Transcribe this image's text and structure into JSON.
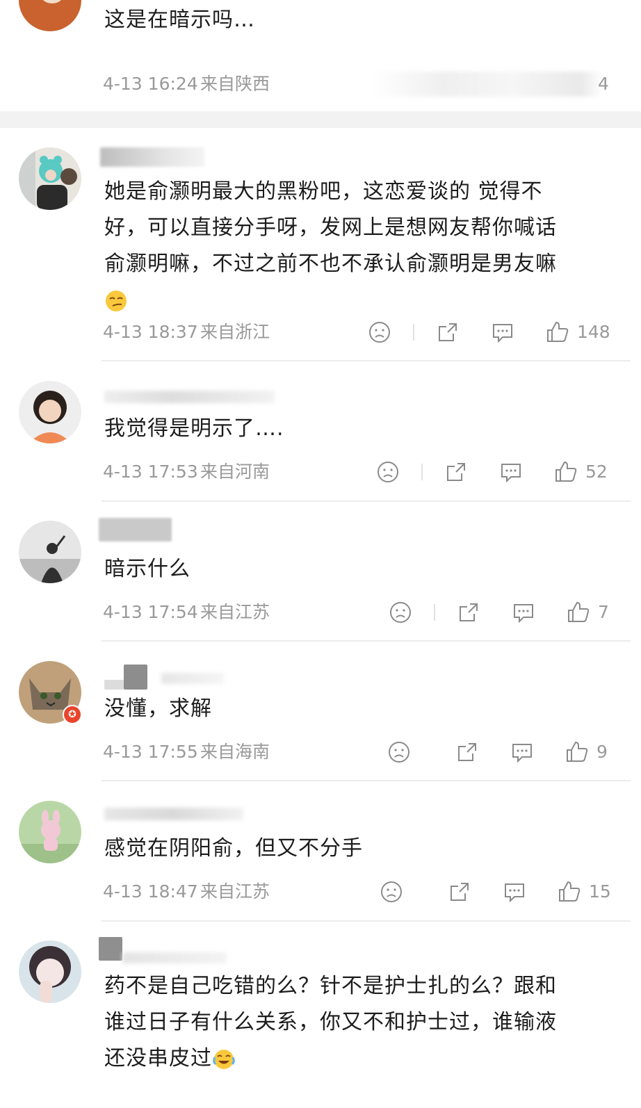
{
  "top_comment": {
    "text": "这是在暗示吗…",
    "date": "4-13 16:24",
    "location": "来自陕西",
    "likes": "4"
  },
  "comments": [
    {
      "text_lines": [
        "她是俞灏明最大的黑粉吧，这恋爱谈的 觉得不",
        "好，可以直接分手呀，发网上是想网友帮你喊话",
        "俞灏明嘛，不过之前不也不承认俞灏明是男友嘛"
      ],
      "trailing_emoji": "smirk-emoji",
      "date": "4-13 18:37",
      "location": "来自浙江",
      "likes": "148"
    },
    {
      "text": "我觉得是明示了….",
      "date": "4-13 17:53",
      "location": "来自河南",
      "likes": "52"
    },
    {
      "text": "暗示什么",
      "date": "4-13 17:54",
      "location": "来自江苏",
      "likes": "7"
    },
    {
      "text": "没懂，求解",
      "date": "4-13 17:55",
      "location": "来自海南",
      "likes": "9"
    },
    {
      "text": "感觉在阴阳俞，但又不分手",
      "date": "4-13 18:47",
      "location": "来自江苏",
      "likes": "15"
    },
    {
      "text_lines": [
        "药不是自己吃错的么？针不是护士扎的么？跟和",
        "谁过日子有什么关系，你又不和护士过，谁输液",
        "还没串皮过"
      ],
      "trailing_emoji": "laugh-cry-emoji"
    }
  ],
  "icons": {
    "dislike": "sad-face-icon",
    "share": "share-icon",
    "comment": "comment-bubble-icon",
    "like": "thumbs-up-icon"
  },
  "colors": {
    "text": "#1c1c1c",
    "meta": "#999999",
    "divider": "#ececec",
    "section_gap": "#f2f2f2"
  }
}
